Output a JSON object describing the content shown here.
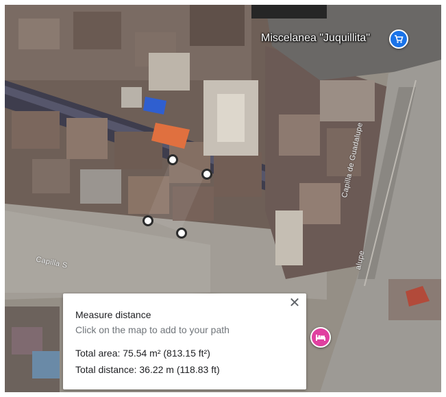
{
  "map": {
    "places": [
      {
        "name": "Miscelanea \"Juquillita\"",
        "icon": "shopping-cart-icon",
        "color": "#1a73e8"
      },
      {
        "name": "",
        "icon": "hotel-bed-icon",
        "color": "#e040a0"
      }
    ],
    "roads": [
      "Capilla S",
      "Capilla de Guadalupe",
      "alupe"
    ],
    "measured_path_points": 4
  },
  "panel": {
    "title": "Measure distance",
    "hint": "Click on the map to add to your path",
    "total_area": "Total area: 75.54 m² (813.15 ft²)",
    "total_distance": "Total distance: 36.22 m (118.83 ft)",
    "close_icon": "close-icon"
  }
}
